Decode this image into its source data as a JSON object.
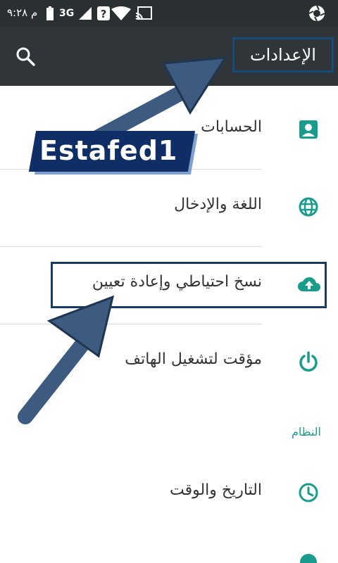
{
  "statusbar": {
    "time": "م ٩:٢٨",
    "network": "3G",
    "icons": [
      "sim-icon",
      "signal-icon",
      "wifi-question-icon",
      "wifi-icon",
      "cast-icon",
      "camera-shutter-icon"
    ]
  },
  "appbar": {
    "title": "الإعدادات",
    "search_icon": "search-icon"
  },
  "list": {
    "items": [
      {
        "label": "الحسابات",
        "icon": "account-icon"
      },
      {
        "label": "اللغة والإدخال",
        "icon": "globe-icon"
      },
      {
        "label": "نسخ احتياطي وإعادة تعيين",
        "icon": "cloud-upload-icon"
      },
      {
        "label": "مؤقت لتشغيل الهاتف",
        "icon": "power-icon"
      }
    ]
  },
  "section": {
    "title": "النظام",
    "items": [
      {
        "label": "التاريخ والوقت",
        "icon": "clock-icon"
      }
    ]
  },
  "watermark": "Estafed1",
  "colors": {
    "accent": "#1a9c8c",
    "appbar": "#2f3538",
    "statusbar": "#2a2f32",
    "highlight": "#183b63"
  }
}
